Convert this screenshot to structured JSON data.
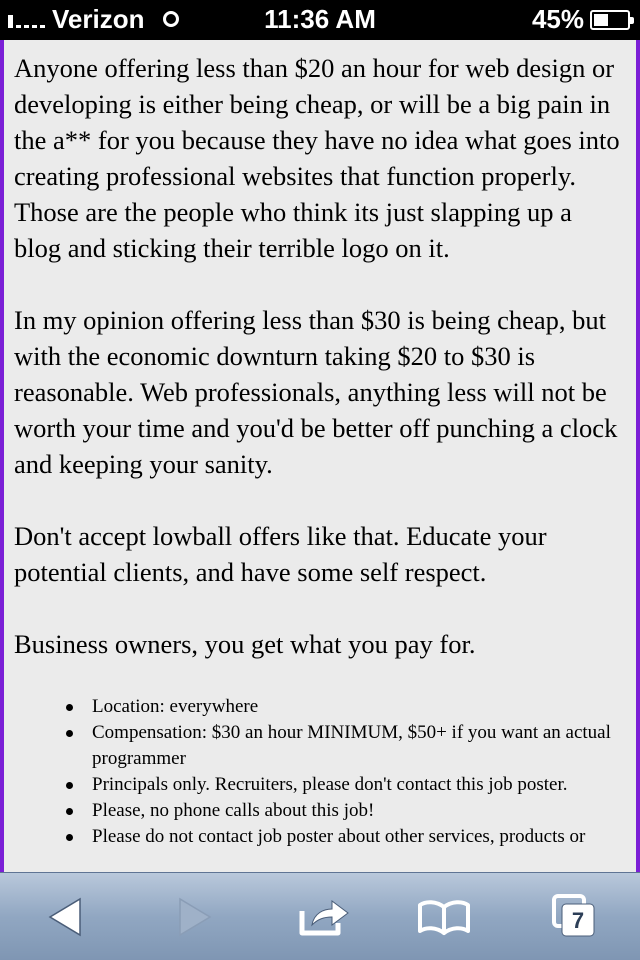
{
  "status_bar": {
    "carrier": "Verizon",
    "time": "11:36 AM",
    "battery_percent": "45%",
    "battery_level": 0.45
  },
  "content": {
    "paragraphs": [
      "Anyone offering less than $20 an hour for web design or developing is either being cheap, or will be a big pain in the a** for you because they have no idea what goes into creating professional websites that function properly. Those are the people who think its just slapping up a blog and sticking their terrible logo on it.",
      "In my opinion offering less than $30 is being cheap, but with the economic downturn taking $20 to $30 is reasonable. Web professionals, anything less will not be worth your time and you'd be better off punching a clock and keeping your sanity.",
      "Don't accept lowball offers like that. Educate your potential clients, and have some self respect.",
      "Business owners, you get what you pay for."
    ],
    "details": [
      "Location: everywhere",
      "Compensation: $30 an hour MINIMUM, $50+ if you want an actual programmer",
      "Principals only. Recruiters, please don't contact this job poster.",
      "Please, no phone calls about this job!",
      "Please do not contact job poster about other services, products or"
    ]
  },
  "toolbar": {
    "tabs_count": "7",
    "icons": [
      "back-arrow-icon",
      "forward-arrow-icon",
      "share-icon",
      "bookmarks-icon",
      "tabs-icon"
    ]
  },
  "colors": {
    "content_background": "#ebebeb",
    "side_border": "#7b1fd6",
    "toolbar_gradient": [
      "#b9c8db",
      "#7f96b3"
    ]
  }
}
